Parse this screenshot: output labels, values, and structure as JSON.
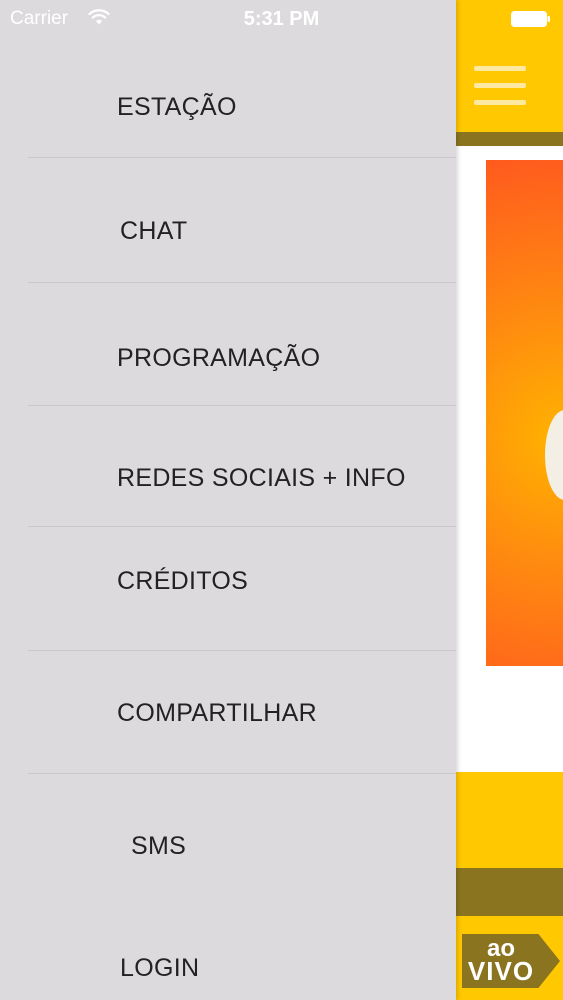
{
  "status_bar": {
    "carrier": "Carrier",
    "time": "5:31 PM",
    "wifi_icon": "wifi-icon",
    "battery_icon": "battery-icon"
  },
  "menu": {
    "items": [
      {
        "label": "ESTAÇÃO"
      },
      {
        "label": "CHAT"
      },
      {
        "label": "PROGRAMAÇÃO"
      },
      {
        "label": "REDES SOCIAIS + INFO"
      },
      {
        "label": "CRÉDITOS"
      },
      {
        "label": "COMPARTILHAR"
      },
      {
        "label": "SMS"
      },
      {
        "label": "LOGIN"
      }
    ]
  },
  "app": {
    "menu_icon": "hamburger-menu-icon",
    "live_badge_line1": "ao",
    "live_badge_line2": "VIVO"
  },
  "colors": {
    "drawer_bg": "#dcdadd",
    "brand_yellow": "#ffc800",
    "brand_dark": "#8a7420",
    "banner_orange": "#ff8a10"
  }
}
